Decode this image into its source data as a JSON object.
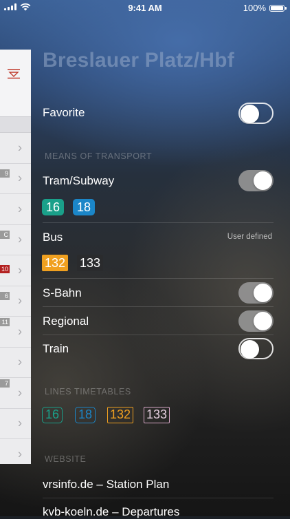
{
  "status": {
    "time": "9:41 AM",
    "battery": "100%"
  },
  "sidebar": {
    "tags": [
      "9",
      "C",
      "10",
      "6",
      "11",
      "7"
    ]
  },
  "station": {
    "title": "Breslauer Platz/Hbf",
    "favorite_label": "Favorite",
    "favorite_on": false
  },
  "transport": {
    "header": "MEANS OF TRANSPORT",
    "tram": {
      "label": "Tram/Subway",
      "on": true,
      "lines": [
        "16",
        "18"
      ]
    },
    "bus": {
      "label": "Bus",
      "note": "User defined",
      "lines": [
        "132",
        "133"
      ]
    },
    "sbahn": {
      "label": "S-Bahn",
      "on": true
    },
    "regional": {
      "label": "Regional",
      "on": true
    },
    "train": {
      "label": "Train",
      "on": false
    }
  },
  "timetables": {
    "header": "LINES TIMETABLES",
    "lines": [
      "16",
      "18",
      "132",
      "133"
    ]
  },
  "website": {
    "header": "WEBSITE",
    "links": [
      "vrsinfo.de – Station Plan",
      "kvb-koeln.de – Departures"
    ]
  },
  "colors": {
    "line16": "#1aa08a",
    "line18": "#1b86c8",
    "line132": "#f0a020",
    "line133_outline": "#d8a8c8"
  }
}
